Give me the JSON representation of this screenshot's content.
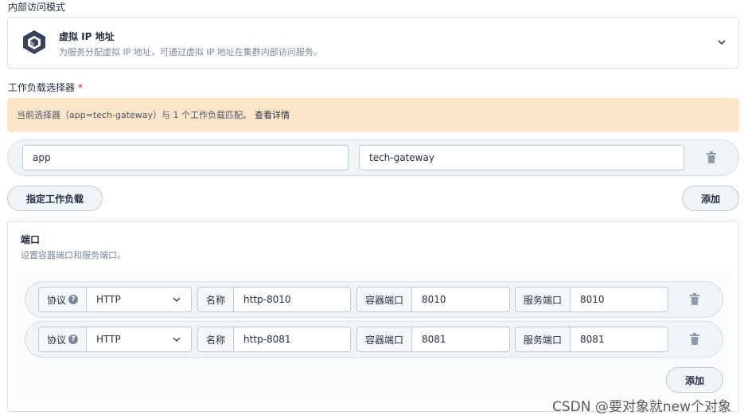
{
  "internal_access": {
    "label": "内部访问模式",
    "mode_title": "虚拟 IP 地址",
    "mode_desc": "为服务分配虚拟 IP 地址，可通过虚拟 IP 地址在集群内部访问服务。",
    "icon": "cube-icon"
  },
  "workload_selector": {
    "label": "工作负载选择器",
    "required_mark": "*",
    "alert_text": "当前选择器（app=tech-gateway）与 1 个工作负载匹配。",
    "alert_link": "查看详情",
    "key_value": "app",
    "value_value": "tech-gateway",
    "specify_button": "指定工作负载",
    "add_button": "添加"
  },
  "ports": {
    "title": "端口",
    "desc": "设置容器端口和服务端口。",
    "protocol_label": "协议",
    "name_label": "名称",
    "container_port_label": "容器端口",
    "service_port_label": "服务端口",
    "rows": [
      {
        "protocol": "HTTP",
        "name": "http-8010",
        "container_port": "8010",
        "service_port": "8010"
      },
      {
        "protocol": "HTTP",
        "name": "http-8081",
        "container_port": "8081",
        "service_port": "8081"
      }
    ],
    "add_button": "添加"
  },
  "watermark": "CSDN @要对象就new个对象",
  "colors": {
    "alert_bg": "#fde5c8",
    "text": "#242e42",
    "muted": "#79879c",
    "row_bg": "#eff4f9"
  }
}
